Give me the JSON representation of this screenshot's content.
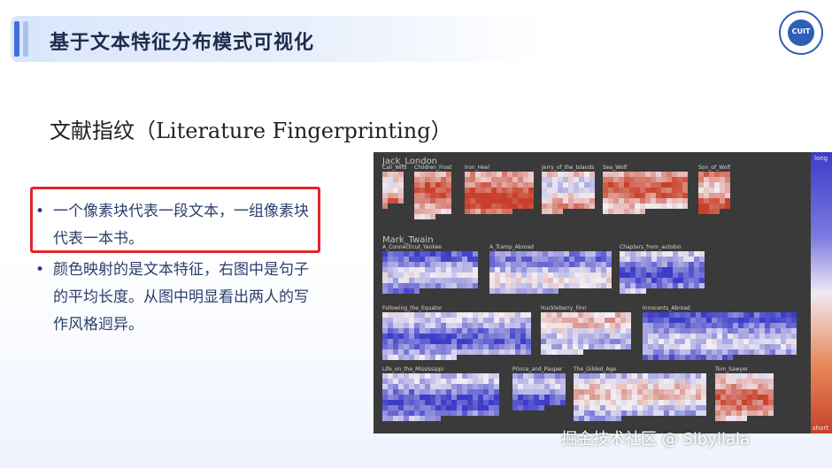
{
  "slide": {
    "title": "基于文本特征分布模式可视化",
    "logo_text": "CUIT",
    "subtitle": "文献指纹（Literature Fingerprinting）",
    "bullets": [
      "一个像素块代表一段文本，一组像素块代表一本书。",
      "颜色映射的是文本特征，右图中是句子的平均长度。从图中明显看出两人的写作风格迥异。"
    ],
    "bullet_marker": "•",
    "watermark": "掘金技术社区 @ Sibyllala"
  },
  "fingerprint": {
    "scale_long": "long",
    "scale_short": "short",
    "colors": {
      "long": "#3c3cc8",
      "mid": "#f2eff4",
      "short": "#c9402a",
      "background": "#3a3a3a"
    },
    "authors": [
      {
        "name": "Jack_London",
        "books": [
          {
            "label": "Call_Wild",
            "bias": 0.35
          },
          {
            "label": "Children_Frost",
            "bias": 0.55
          },
          {
            "label": "Iron_Heel",
            "bias": 0.75
          },
          {
            "label": "Jerry_of_the_Islands",
            "bias": 0.15
          },
          {
            "label": "Sea_Wolf",
            "bias": 0.55
          },
          {
            "label": "Son_of_Wolf",
            "bias": 0.6
          }
        ]
      },
      {
        "name": "Mark_Twain",
        "books": [
          {
            "label": "A_Connecticut_Yankee",
            "bias": -0.45
          },
          {
            "label": "A_Tramp_Abroad",
            "bias": -0.3
          },
          {
            "label": "Chapters_from_autobio",
            "bias": -0.55
          },
          {
            "label": "Following_the_Equator",
            "bias": -0.45
          },
          {
            "label": "Huckleberry_Finn",
            "bias": 0.0
          },
          {
            "label": "Innocents_Abroad",
            "bias": -0.5
          },
          {
            "label": "Life_on_the_Mississippi",
            "bias": -0.55
          },
          {
            "label": "Prince_and_Pauper",
            "bias": -0.5
          },
          {
            "label": "The_Gilded_Age",
            "bias": -0.05
          },
          {
            "label": "Tom_Sawyer",
            "bias": 0.45
          }
        ]
      }
    ]
  }
}
